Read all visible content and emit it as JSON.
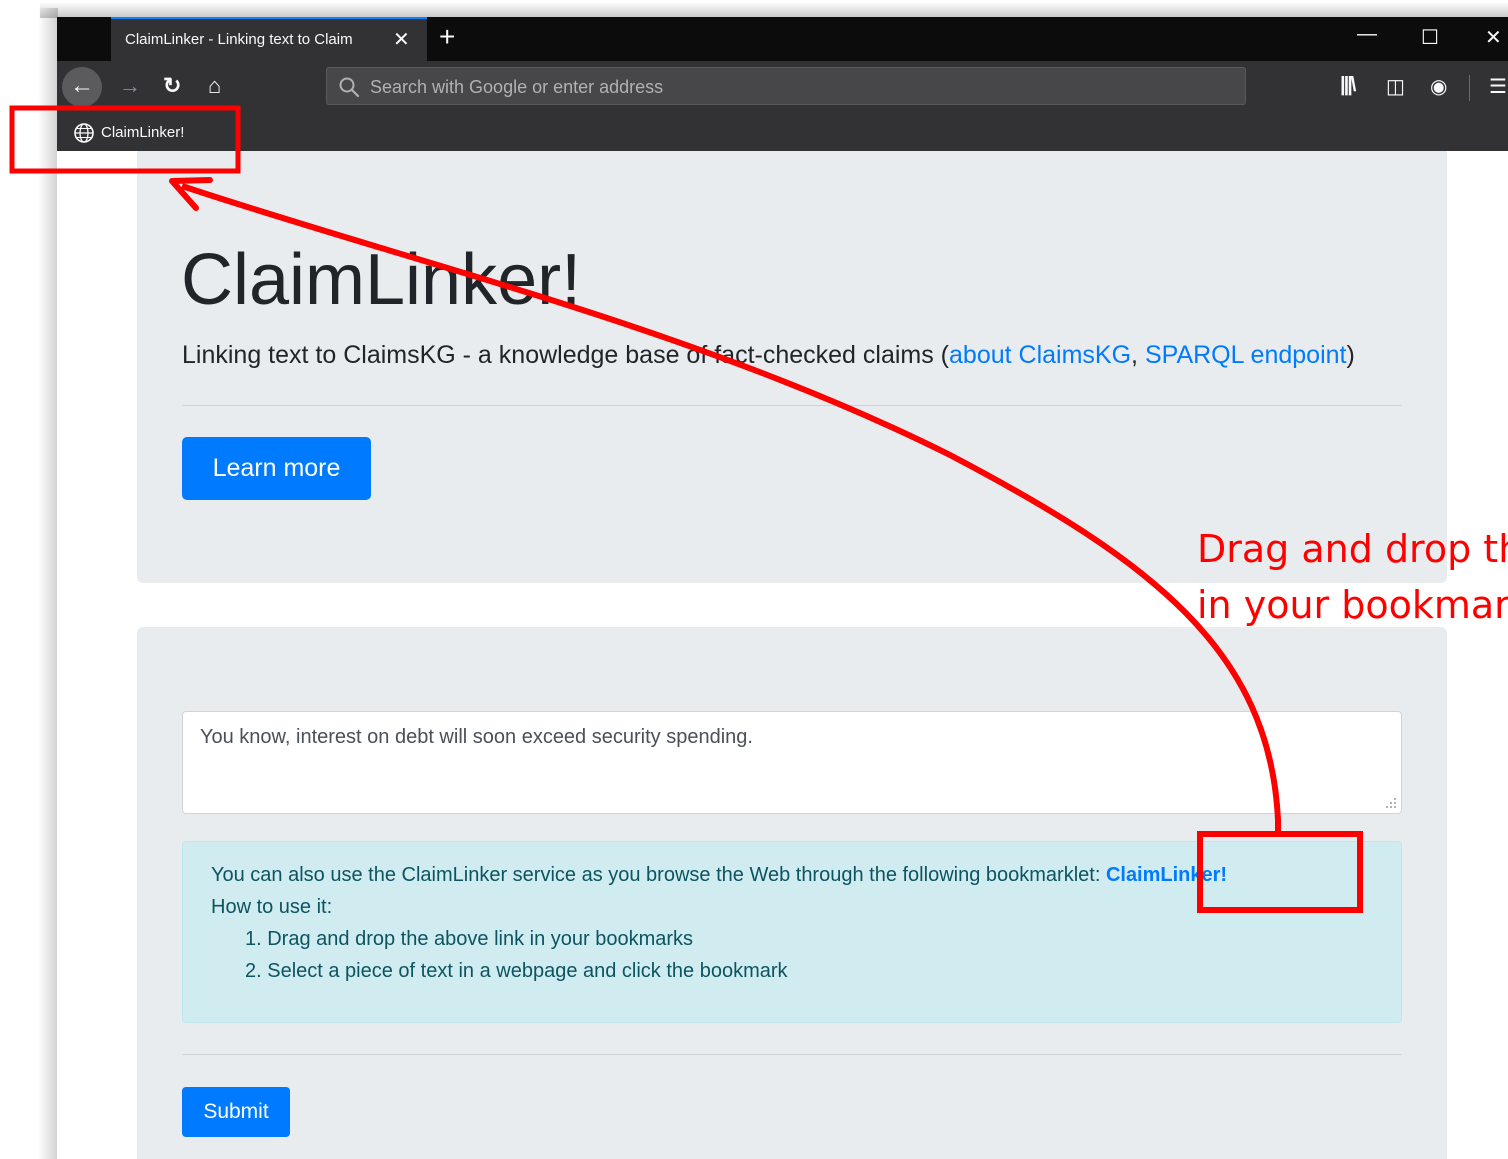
{
  "browser": {
    "tab_title": "ClaimLinker - Linking text to Claim",
    "tab_close": "✕",
    "new_tab": "+",
    "window_controls": {
      "minimize": "—",
      "maximize": "☐",
      "close": "✕"
    },
    "url_placeholder": "Search with Google or enter address",
    "bookmark_item": "ClaimLinker!",
    "icons": [
      "back-icon",
      "forward-icon",
      "reload-icon",
      "home-icon",
      "search-icon",
      "library-icon",
      "sidebar-icon",
      "account-icon",
      "menu-icon",
      "globe-icon"
    ]
  },
  "jumbotron": {
    "title": "ClaimLinker!",
    "lead_prefix": "Linking text to ClaimsKG - a knowledge base of fact-checked claims (",
    "link_about": "about ClaimsKG",
    "separator": ", ",
    "link_sparql": "SPARQL endpoint",
    "lead_suffix": ")",
    "learn_more": "Learn more"
  },
  "form": {
    "textarea_value": "You know, interest on debt will soon exceed security spending.",
    "alert": {
      "line1_prefix": "You can also use the ClaimLinker service as you browse the Web through the following bookmarklet: ",
      "bookmarklet_link": "ClaimLinker!",
      "line2": "How to use it:",
      "step1": "1. Drag and drop the above link in your bookmarks",
      "step2": "2. Select a piece of text in a webpage and click the bookmark"
    },
    "submit": "Submit"
  },
  "annotation": {
    "line1": "Drag and drop th",
    "line2": "in your bookmar",
    "color": "#ff0000"
  },
  "colors": {
    "primary": "#007bff",
    "alert_bg": "#d1ecf1",
    "alert_text": "#0c5460",
    "jumbotron_bg": "#e9ecef",
    "browser_dark": "#323234"
  }
}
